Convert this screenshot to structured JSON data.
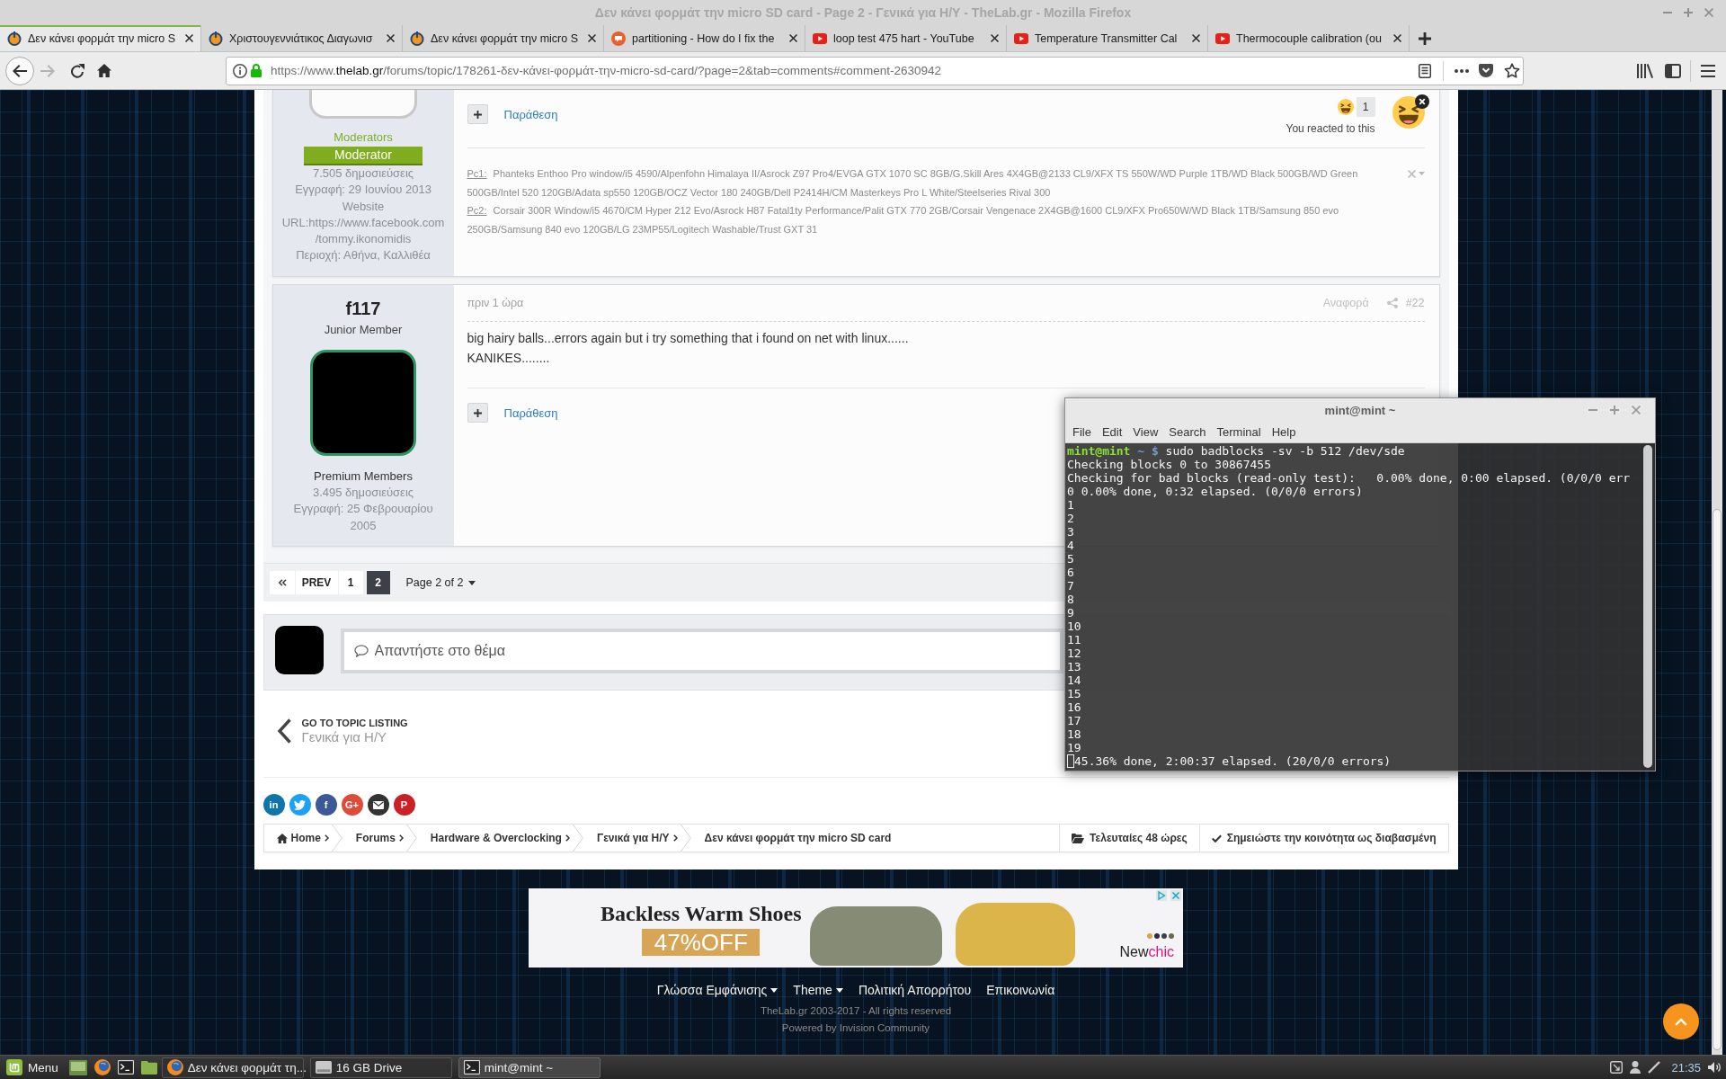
{
  "window": {
    "title": "Δεν κάνει φορμάτ την micro SD card - Page 2 - Γενικά για Η/Υ - TheLab.gr - Mozilla Firefox"
  },
  "tabs": [
    {
      "title": "Δεν κάνει φορμάτ την micro S",
      "kind": "ring",
      "selected": true
    },
    {
      "title": "Χριστουγεννιάτικος Διαγωνισ",
      "kind": "ring",
      "selected": false
    },
    {
      "title": "Δεν κάνει φορμάτ την micro S",
      "kind": "ring",
      "selected": false
    },
    {
      "title": "partitioning - How do I fix the",
      "kind": "bubble",
      "selected": false
    },
    {
      "title": "loop test 475 hart - YouTube",
      "kind": "video",
      "selected": false
    },
    {
      "title": "Temperature Transmitter Cal",
      "kind": "video",
      "selected": false
    },
    {
      "title": "Thermocouple calibration (ou",
      "kind": "video",
      "selected": false
    }
  ],
  "toolbar": {
    "nav_buttons": [
      {
        "kind": "back",
        "disabled": false
      },
      {
        "kind": "forward",
        "disabled": true
      },
      {
        "kind": "reload",
        "disabled": false
      },
      {
        "kind": "home",
        "disabled": false
      }
    ],
    "address": {
      "prefix": "https://www.",
      "domain": "thelab.gr",
      "path": "/forums/topic/178261-δεν-κάνει-φορμάτ-την-micro-sd-card/?page=2&tab=comments#comment-2630942"
    }
  },
  "posts": [
    {
      "author": {
        "group": {
          "name": "Moderators",
          "color": "#7ab02c"
        },
        "badge": "Moderator",
        "stats": [
          "7.505 δημοσιεύσεις",
          "Εγγραφή: 29 Ιουνίου 2013",
          "Website URL:https://www.facebook.com/tommy.ikonomidis",
          "Περιοχή: Αθήνα, Καλλιθέα"
        ]
      },
      "quote": "Παράθεση",
      "reaction": {
        "count": "1",
        "note": "You reacted to this"
      },
      "signature": [
        {
          "label": "Pc1:",
          "text": "Phanteks Enthoo Pro window/i5 4590/Alpenfohn Himalaya II/Asrock Z97 Pro4/EVGA GTX 1070 SC 8GB/G.Skill Ares 4X4GB@2133 CL9/XFX TS 550W/WD Purple 1TB/WD Black 500GB/WD Green 500GB/Intel 520 120GB/Adata sp550 120GB/OCZ Vector 180 240GB/Dell P2414H/CM Masterkeys Pro L White/Steelseries Rival 300"
        },
        {
          "label": "Pc2:",
          "text": "Corsair 300R Window/i5 4670/CM Hyper 212 Evo/Asrock H87 Fatal1ty Performance/Palit GTX 770 2GB/Corsair Vengenace 2X4GB@1600 CL9/XFX Pro650W/WD Black 1TB/Samsung 850 evo 250GB/Samsung 840 evo 120GB/LG 23MP55/Logitech Washable/Trust GXT 31"
        }
      ]
    },
    {
      "author": {
        "name": "f117",
        "rank": "Junior Member",
        "group": {
          "name": "Premium Members",
          "color": "#333333"
        },
        "stats": [
          "3.495 δημοσιεύσεις",
          "Εγγραφή: 25 Φεβρουαρίου 2005"
        ]
      },
      "time": "πριν 1 ώρα",
      "report": "Αναφορά",
      "number": "#22",
      "body": [
        "big hairy balls...errors again but i try something that i found on net with linux......",
        "KANIKES........"
      ],
      "quote": "Παράθεση"
    }
  ],
  "pagination": {
    "prev": "PREV",
    "pages": [
      {
        "label": "1",
        "selected": false
      },
      {
        "label": "2",
        "selected": true
      }
    ],
    "page_menu": "Page 2 of 2"
  },
  "reply": {
    "placeholder": "Απαντήστε στο θέμα"
  },
  "topic_listing": {
    "label": "GO TO TOPIC LISTING",
    "forum": "Γενικά για Η/Υ"
  },
  "share_buttons": [
    {
      "kind": "letters",
      "label": "in",
      "color": "#0e76a8"
    },
    {
      "kind": "bird",
      "color": "#1da1f2"
    },
    {
      "kind": "letters",
      "label": "f",
      "color": "#3b5998"
    },
    {
      "kind": "letters",
      "label": "G+",
      "color": "#dd4b39"
    },
    {
      "kind": "envelope",
      "color": "#333333"
    },
    {
      "kind": "letters",
      "label": "P",
      "color": "#cb2027"
    }
  ],
  "breadcrumb": {
    "items": [
      {
        "kind": "home",
        "label": "Home"
      },
      {
        "kind": "link",
        "label": "Forums"
      },
      {
        "kind": "link",
        "label": "Hardware & Overclocking"
      },
      {
        "kind": "link",
        "label": "Γενικά για Η/Υ"
      },
      {
        "kind": "current",
        "label": "Δεν κάνει φορμάτ την micro SD card"
      }
    ],
    "actions": [
      {
        "kind": "folder",
        "label": "Τελευταίες 48 ώρες"
      },
      {
        "kind": "check",
        "label": "Σημειώστε την κοινότητα ως διαβασμένη"
      }
    ]
  },
  "advert": {
    "headline": "Backless Warm Shoes",
    "offer": "47%OFF",
    "brand": [
      {
        "text": "New",
        "color": "#222222"
      },
      {
        "text": "chic",
        "color": "#e0147c"
      }
    ]
  },
  "footer": {
    "links": [
      {
        "label": "Γλώσσα Εμφάνισης",
        "dropdown": true
      },
      {
        "label": "Theme",
        "dropdown": true
      },
      {
        "label": "Πολιτική Απορρήτου",
        "dropdown": false
      },
      {
        "label": "Επικοινωνία",
        "dropdown": false
      }
    ],
    "copyright": "TheLab.gr 2003-2017 - All rights reserved",
    "powered_by": "Powered by Invision Community"
  },
  "terminal": {
    "title": "mint@mint ~",
    "menu": [
      "File",
      "Edit",
      "View",
      "Search",
      "Terminal",
      "Help"
    ],
    "prompt": {
      "user_host": "mint@mint",
      "cwd": "~",
      "symbol": "$",
      "command": "sudo badblocks -sv -b 512 /dev/sde"
    },
    "output": [
      "Checking blocks 0 to 30867455",
      "Checking for bad blocks (read-only test):   0.00% done, 0:00 elapsed. (0/0/0 err",
      "0 0.00% done, 0:32 elapsed. (0/0/0 errors)",
      "1",
      "2",
      "3",
      "4",
      "5",
      "6",
      "7",
      "8",
      "9",
      "10",
      "11",
      "12",
      "13",
      "14",
      "15",
      "16",
      "17",
      "18",
      "19"
    ],
    "current_line": "45.36% done, 2:00:37 elapsed. (20/0/0 errors)"
  },
  "taskbar": {
    "menu": "Menu",
    "launchers": [
      {
        "kind": "desktop"
      },
      {
        "kind": "browser"
      },
      {
        "kind": "terminal"
      },
      {
        "kind": "folder"
      }
    ],
    "windows": [
      {
        "kind": "browser",
        "title": "Δεν κάνει φορμάτ τη...",
        "selected": false
      },
      {
        "kind": "drive",
        "title": "16 GB Drive",
        "selected": false
      },
      {
        "kind": "terminal",
        "title": "mint@mint ~",
        "selected": true
      }
    ],
    "clock": "21:35"
  }
}
